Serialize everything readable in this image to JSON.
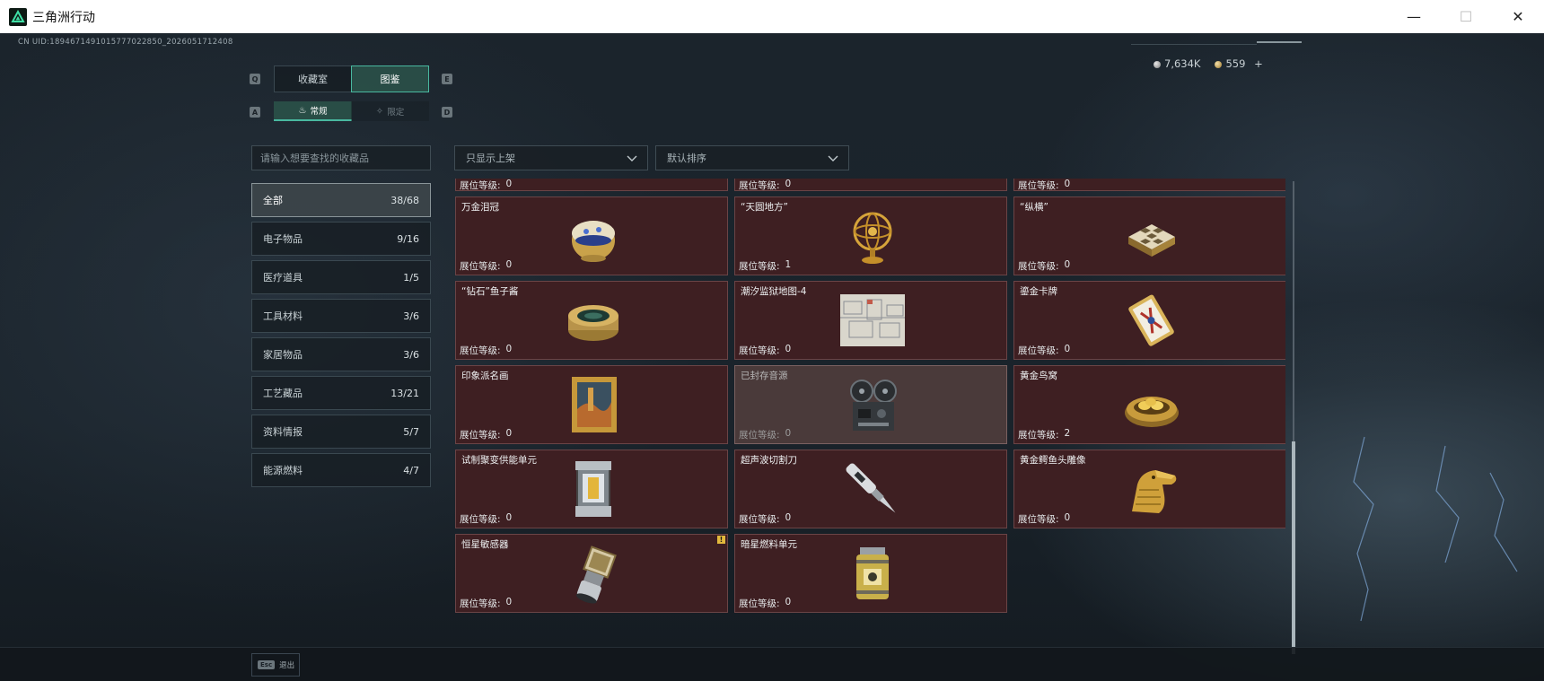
{
  "window": {
    "title": "三角洲行动",
    "controls": {
      "minimize": "—",
      "maximize": "☐",
      "close": "✕"
    }
  },
  "header": {
    "uid": "CN UID:1894671491015777022850_2026051712408",
    "silver": "7,634K",
    "gold": "559",
    "add": "+"
  },
  "keys": {
    "q": "Q",
    "e": "E",
    "a": "A",
    "d": "D"
  },
  "tabs": {
    "main": [
      {
        "label": "收藏室",
        "active": false
      },
      {
        "label": "图鉴",
        "active": true
      }
    ],
    "sub": [
      {
        "label": "常规",
        "active": true
      },
      {
        "label": "限定",
        "active": false
      }
    ]
  },
  "search": {
    "placeholder": "请输入想要查找的收藏品"
  },
  "filters": {
    "shelf": "只显示上架",
    "sort": "默认排序"
  },
  "categories": [
    {
      "label": "全部",
      "count": "38/68",
      "active": true
    },
    {
      "label": "电子物品",
      "count": "9/16"
    },
    {
      "label": "医疗道具",
      "count": "1/5"
    },
    {
      "label": "工具材料",
      "count": "3/6"
    },
    {
      "label": "家居物品",
      "count": "3/6"
    },
    {
      "label": "工艺藏品",
      "count": "13/21"
    },
    {
      "label": "资料情报",
      "count": "5/7"
    },
    {
      "label": "能源燃料",
      "count": "4/7"
    }
  ],
  "level_label": "展位等级:",
  "partial_row": [
    {
      "level": "0"
    },
    {
      "level": "0"
    },
    {
      "level": "0"
    }
  ],
  "items": [
    {
      "name": "万金泪冠",
      "level": "0",
      "icon": "jeweled-egg-icon"
    },
    {
      "name": "“天圆地方”",
      "level": "1",
      "icon": "armillary-sphere-icon"
    },
    {
      "name": "“纵横”",
      "level": "0",
      "icon": "chess-box-icon"
    },
    {
      "name": "“钻石”鱼子酱",
      "level": "0",
      "icon": "caviar-tin-icon"
    },
    {
      "name": "潮汐监狱地图-4",
      "level": "0",
      "icon": "map-icon"
    },
    {
      "name": "鎏金卡牌",
      "level": "0",
      "icon": "gilded-card-icon"
    },
    {
      "name": "印象派名画",
      "level": "0",
      "icon": "painting-icon"
    },
    {
      "name": "已封存音源",
      "level": "0",
      "icon": "reel-recorder-icon",
      "dim": true
    },
    {
      "name": "黄金鸟窝",
      "level": "2",
      "icon": "golden-nest-icon"
    },
    {
      "name": "试制聚变供能单元",
      "level": "0",
      "icon": "fusion-cell-icon"
    },
    {
      "name": "超声波切割刀",
      "level": "0",
      "icon": "ultrasonic-knife-icon"
    },
    {
      "name": "黄金鳄鱼头雕像",
      "level": "0",
      "icon": "gold-crocodile-icon"
    },
    {
      "name": "恒星敏感器",
      "level": "0",
      "icon": "star-sensor-icon",
      "warn": "!"
    },
    {
      "name": "暗星燃料单元",
      "level": "0",
      "icon": "fuel-canister-icon"
    }
  ],
  "footer": {
    "esc_key": "Esc",
    "back": "退出"
  },
  "colors": {
    "accent": "#49b8a0",
    "card": "#3e1f22",
    "card_border": "#6a4446"
  }
}
